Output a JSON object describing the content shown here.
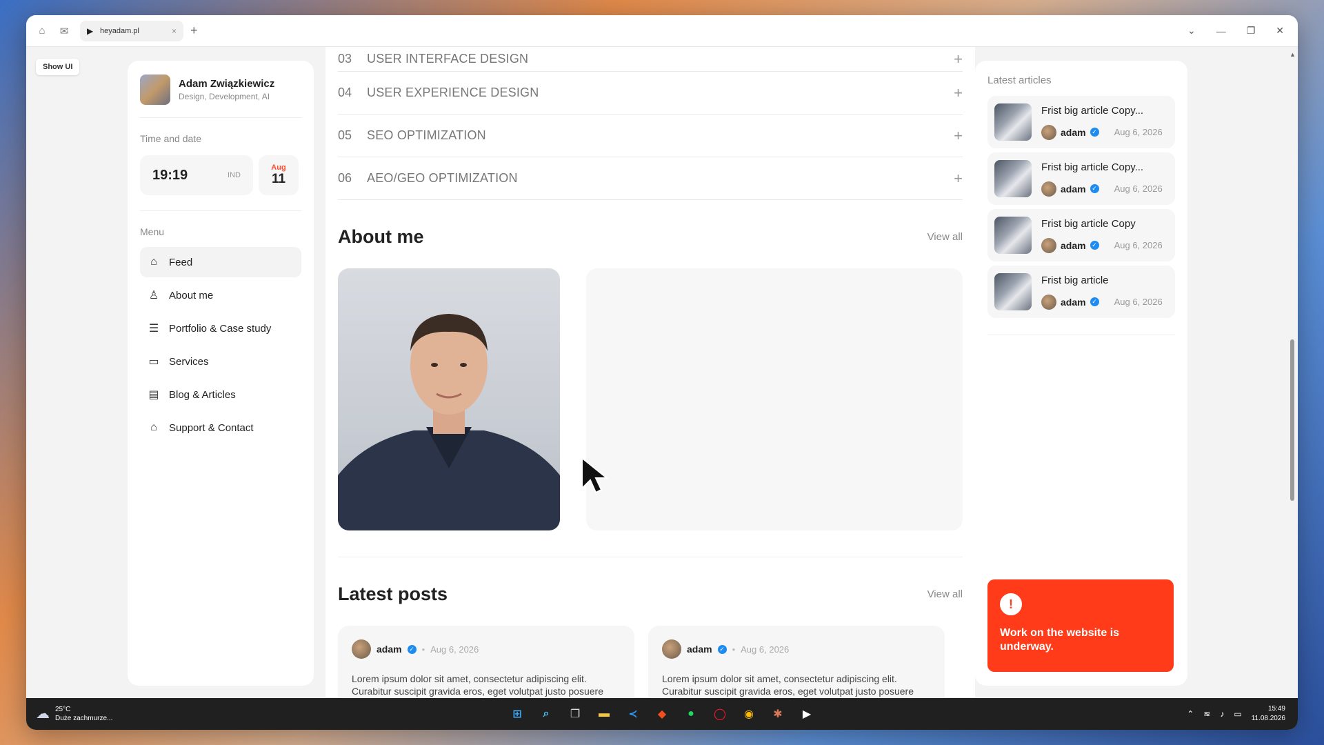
{
  "browser": {
    "tab_title": "heyadam.pl",
    "tab_close": "×",
    "new_tab": "+",
    "show_ui": "Show UI"
  },
  "profile": {
    "name": "Adam Związkiewicz",
    "subtitle": "Design, Development, AI"
  },
  "time_date": {
    "label": "Time and date",
    "time": "19:19",
    "zone": "IND",
    "month": "Aug",
    "day": "11"
  },
  "menu": {
    "label": "Menu",
    "items": [
      {
        "label": "Feed",
        "icon": "home-icon"
      },
      {
        "label": "About me",
        "icon": "user-icon"
      },
      {
        "label": "Portfolio & Case study",
        "icon": "layers-icon"
      },
      {
        "label": "Services",
        "icon": "laptop-icon"
      },
      {
        "label": "Blog & Articles",
        "icon": "document-icon"
      },
      {
        "label": "Support & Contact",
        "icon": "support-icon"
      }
    ]
  },
  "services": [
    {
      "num": "03",
      "title": "USER INTERFACE DESIGN"
    },
    {
      "num": "04",
      "title": "USER EXPERIENCE DESIGN"
    },
    {
      "num": "05",
      "title": "SEO OPTIMIZATION"
    },
    {
      "num": "06",
      "title": "AEO/GEO OPTIMIZATION"
    }
  ],
  "about": {
    "title": "About me",
    "view_all": "View all"
  },
  "latest_posts": {
    "title": "Latest posts",
    "view_all": "View all",
    "posts": [
      {
        "author": "adam",
        "date": "Aug 6, 2026",
        "text": "Lorem ipsum dolor sit amet, consectetur adipiscing elit. Curabitur suscipit gravida eros, eget volutpat justo posuere"
      },
      {
        "author": "adam",
        "date": "Aug 6, 2026",
        "text": "Lorem ipsum dolor sit amet, consectetur adipiscing elit. Curabitur suscipit gravida eros, eget volutpat justo posuere"
      }
    ]
  },
  "latest_articles": {
    "title": "Latest articles",
    "items": [
      {
        "title": "Frist big article Copy...",
        "author": "adam",
        "date": "Aug 6, 2026"
      },
      {
        "title": "Frist big article Copy...",
        "author": "adam",
        "date": "Aug 6, 2026"
      },
      {
        "title": "Frist big article Copy",
        "author": "adam",
        "date": "Aug 6, 2026"
      },
      {
        "title": "Frist big article",
        "author": "adam",
        "date": "Aug 6, 2026"
      }
    ]
  },
  "alert": {
    "icon": "!",
    "text": "Work on the website is underway."
  },
  "taskbar": {
    "temp": "25°C",
    "weather": "Duże zachmurze...",
    "time": "15:49",
    "date": "11.08.2026"
  },
  "colors": {
    "accent": "#ff3b1a",
    "verified": "#1d8bf0"
  }
}
